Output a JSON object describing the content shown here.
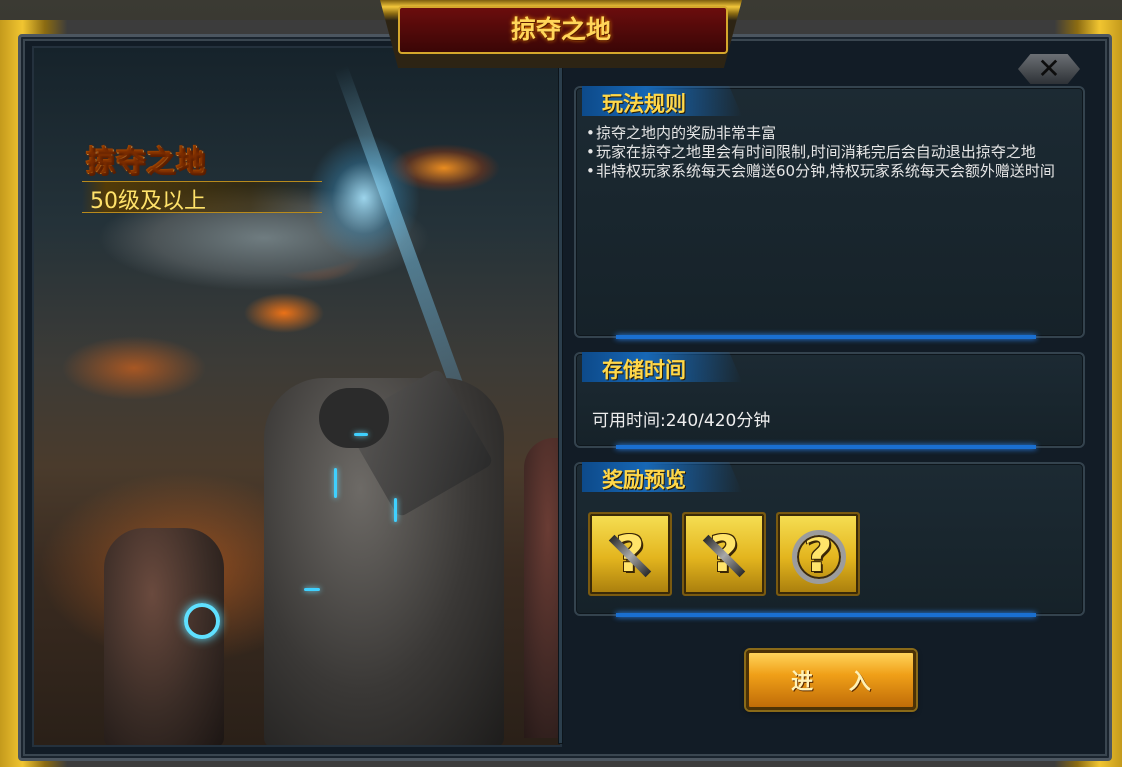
{
  "window": {
    "title": "掠夺之地"
  },
  "art": {
    "title": "掠夺之地",
    "level": "50级及以上"
  },
  "rules_panel": {
    "header": "玩法规则",
    "items": [
      "掠夺之地内的奖励非常丰富",
      "玩家在掠夺之地里会有时间限制,时间消耗完后会自动退出掠夺之地",
      "非特权玩家系统每天会赠送60分钟,特权玩家系统每天会额外赠送时间"
    ],
    "bullet": "•"
  },
  "time_panel": {
    "header": "存储时间",
    "text": "可用时间:240/420分钟"
  },
  "reward_panel": {
    "header": "奖励预览",
    "rewards": [
      {
        "icon": "unknown-weapon-reward-icon",
        "mark": "?"
      },
      {
        "icon": "unknown-weapon-reward-icon",
        "mark": "?"
      },
      {
        "icon": "unknown-ring-reward-icon",
        "mark": "?"
      }
    ]
  },
  "actions": {
    "enter_label": "进 入",
    "close_icon": "close-icon"
  },
  "colors": {
    "accent_gold": "#ffd84a",
    "panel_bar_blue": "#1a6fd0",
    "header_red": "#6b0d0d"
  }
}
